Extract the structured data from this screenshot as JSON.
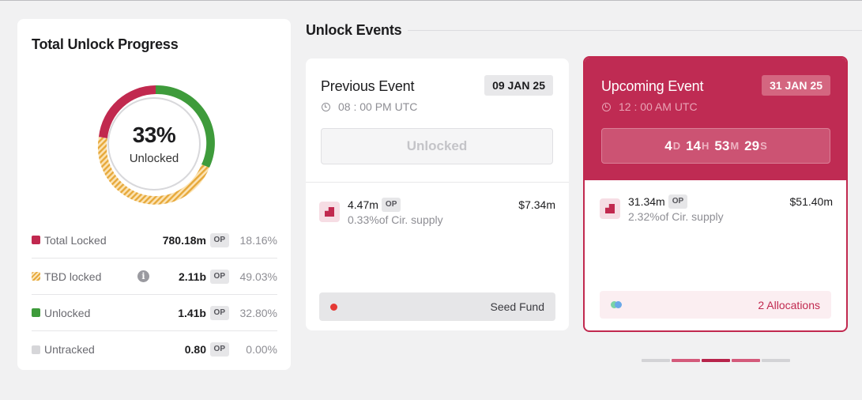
{
  "progress": {
    "title": "Total Unlock Progress",
    "percent": "33%",
    "percent_label": "Unlocked",
    "legend": [
      {
        "name": "Total Locked",
        "value": "780.18m",
        "unit": "OP",
        "pct": "18.16%",
        "color": "#c1294f"
      },
      {
        "name": "TBD locked",
        "value": "2.11b",
        "unit": "OP",
        "pct": "49.03%",
        "color": "#e7a93b",
        "info_icon": "i"
      },
      {
        "name": "Unlocked",
        "value": "1.41b",
        "unit": "OP",
        "pct": "32.80%",
        "color": "#3e9b3b"
      },
      {
        "name": "Untracked",
        "value": "0.80",
        "unit": "OP",
        "pct": "0.00%",
        "color": "#d6d6d9"
      }
    ]
  },
  "events": {
    "title": "Unlock Events",
    "previous": {
      "name": "Previous Event",
      "date": "09 JAN 25",
      "time": "08 : 00 PM UTC",
      "status": "Unlocked",
      "amount": "4.47m",
      "unit": "OP",
      "supply": "0.33%of Cir. supply",
      "usd": "$7.34m",
      "footer": "Seed Fund"
    },
    "upcoming": {
      "name": "Upcoming Event",
      "date": "31 JAN 25",
      "time": "12 : 00 AM UTC",
      "countdown": {
        "d": "4",
        "d_unit": "D",
        "h": "14",
        "h_unit": "H",
        "m": "53",
        "m_unit": "M",
        "s": "29",
        "s_unit": "S"
      },
      "amount": "31.34m",
      "unit": "OP",
      "supply": "2.32%of Cir. supply",
      "usd": "$51.40m",
      "footer": "2 Allocations"
    }
  },
  "pager": {
    "count": 5,
    "active_index": 2
  }
}
